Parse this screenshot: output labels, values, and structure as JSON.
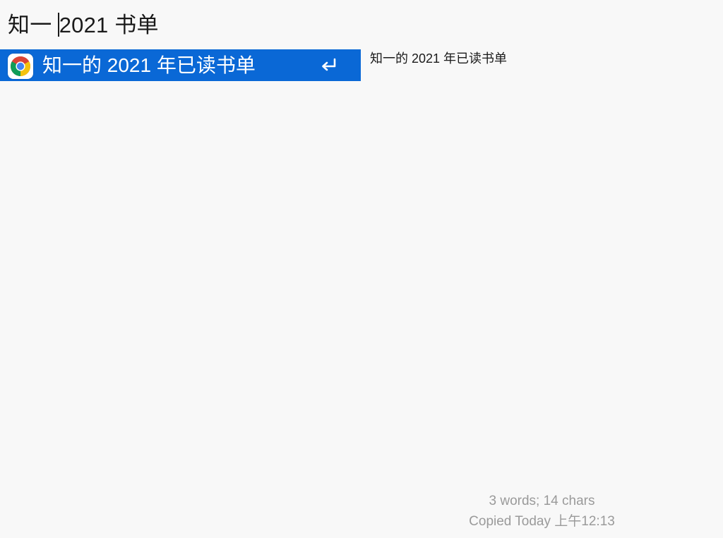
{
  "search": {
    "query_before_caret": "知一 ",
    "query_after_caret": "2021 书单"
  },
  "results": [
    {
      "title": "知一的 2021 年已读书单",
      "app_icon": "chrome-icon",
      "action_icon": "return-key-icon",
      "selected": true
    }
  ],
  "preview": {
    "text": "知一的 2021 年已读书单",
    "stats": "3 words; 14 chars",
    "copied": "Copied Today 上午12:13"
  },
  "colors": {
    "selection": "#0a68d6",
    "background": "#f8f8f8",
    "meta_text": "#9a9a9a"
  }
}
